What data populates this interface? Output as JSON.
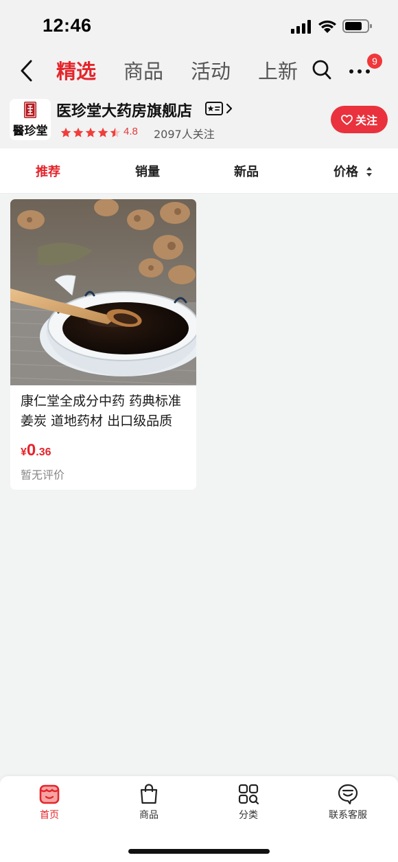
{
  "status_bar": {
    "time": "12:46"
  },
  "nav": {
    "tabs": [
      {
        "label": "精选"
      },
      {
        "label": "商品"
      },
      {
        "label": "活动"
      },
      {
        "label": "上新"
      }
    ],
    "active_tab": 0,
    "more_badge": "9"
  },
  "store": {
    "logo_text": "醫珍堂",
    "name": "医珍堂大药房旗舰店",
    "rating": 4.8,
    "rating_text": "4.8",
    "followers": "2097人关注",
    "follow_label": "关注"
  },
  "sort_bar": {
    "items": [
      {
        "label": "推荐"
      },
      {
        "label": "销量"
      },
      {
        "label": "新品"
      },
      {
        "label": "价格"
      }
    ],
    "active": 0
  },
  "products": [
    {
      "title": "康仁堂全成分中药 药典标准 姜炭 道地药材 出口级品质",
      "price_symbol": "¥",
      "price_int": "0",
      "price_dec": ".36",
      "review": "暂无评价"
    }
  ],
  "bottom_tabs": [
    {
      "label": "首页",
      "icon": "shop-home-icon"
    },
    {
      "label": "商品",
      "icon": "shopping-bag-icon"
    },
    {
      "label": "分类",
      "icon": "category-grid-icon"
    },
    {
      "label": "联系客服",
      "icon": "customer-service-icon"
    }
  ],
  "colors": {
    "accent": "#e4252b",
    "follow_button": "#e9323d",
    "badge": "#f0373a",
    "background": "#f2f3f3"
  }
}
